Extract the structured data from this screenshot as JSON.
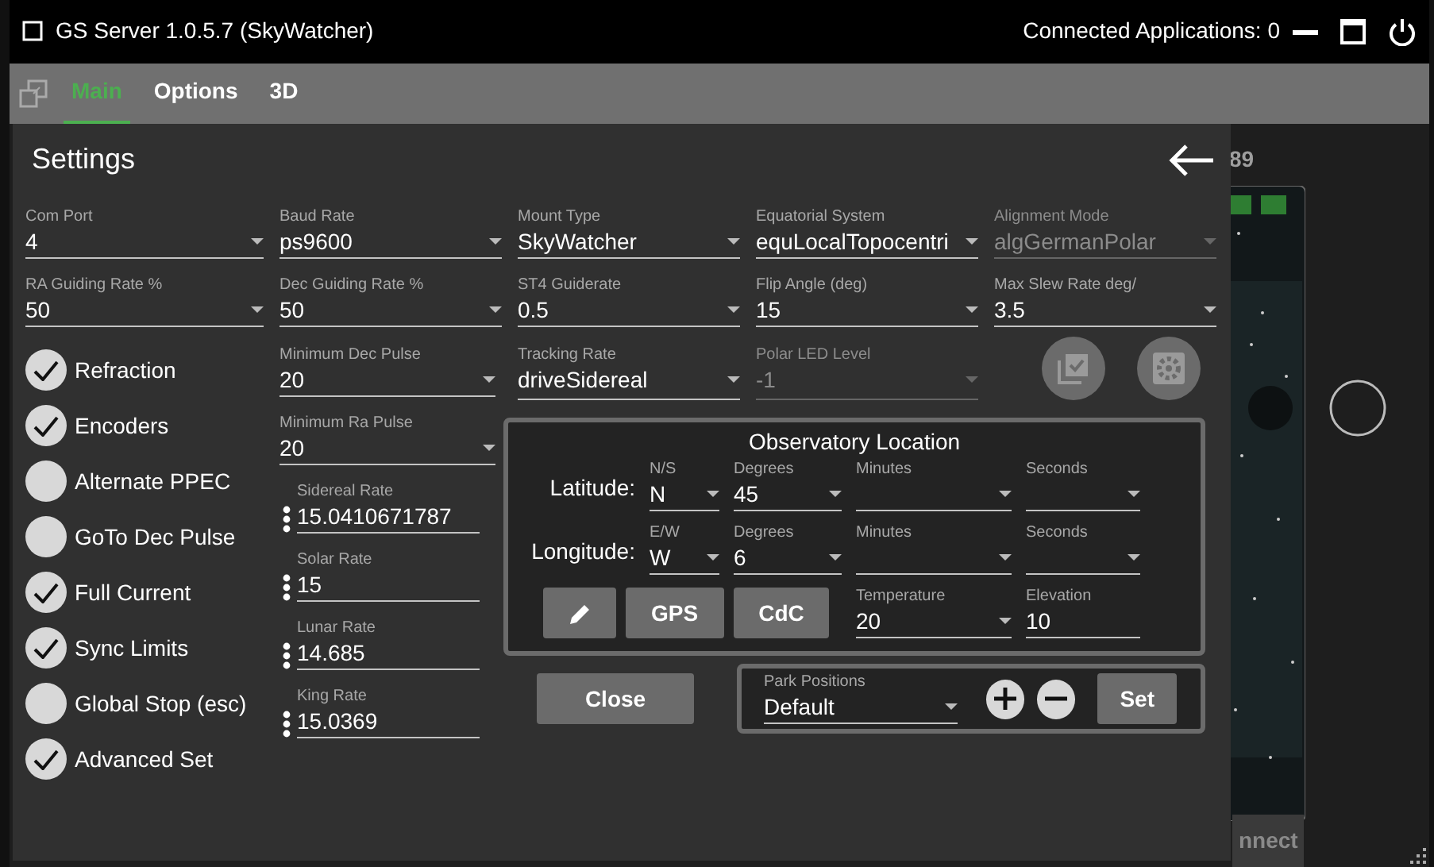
{
  "title_bar": {
    "title": "GS Server 1.0.5.7 (SkyWatcher)",
    "connected": "Connected Applications: 0"
  },
  "tabs": [
    {
      "label": "Main",
      "selected": true
    },
    {
      "label": "Options",
      "selected": false
    },
    {
      "label": "3D",
      "selected": false
    }
  ],
  "background": {
    "number": "89",
    "connect_button": "nnect"
  },
  "settings": {
    "title": "Settings",
    "selects": [
      {
        "label": "Com Port",
        "value": "4",
        "disabled": false
      },
      {
        "label": "Baud Rate",
        "value": "ps9600",
        "disabled": false
      },
      {
        "label": "Mount Type",
        "value": "SkyWatcher",
        "disabled": false
      },
      {
        "label": "Equatorial System",
        "value": "equLocalTopocentri",
        "disabled": false
      },
      {
        "label": "Alignment Mode",
        "value": "algGermanPolar",
        "disabled": true
      },
      {
        "label": "RA Guiding Rate %",
        "value": "50",
        "disabled": false
      },
      {
        "label": "Dec Guiding Rate %",
        "value": "50",
        "disabled": false
      },
      {
        "label": "ST4 Guiderate",
        "value": "0.5",
        "disabled": false
      },
      {
        "label": "Flip Angle (deg)",
        "value": "15",
        "disabled": false
      },
      {
        "label": "Max Slew Rate deg/",
        "value": "3.5",
        "disabled": false
      }
    ],
    "checks": [
      {
        "label": "Refraction",
        "checked": true
      },
      {
        "label": "Encoders",
        "checked": true
      },
      {
        "label": "Alternate PPEC",
        "checked": false
      },
      {
        "label": "GoTo Dec Pulse",
        "checked": false
      },
      {
        "label": "Full Current",
        "checked": true
      },
      {
        "label": "Sync Limits",
        "checked": true
      },
      {
        "label": "Global Stop (esc)",
        "checked": false
      },
      {
        "label": "Advanced Set",
        "checked": true
      }
    ],
    "pulses": [
      {
        "label": "Minimum Dec Pulse",
        "value": "20"
      },
      {
        "label": "Minimum Ra Pulse",
        "value": "20"
      }
    ],
    "rates": [
      {
        "label": "Sidereal Rate",
        "value": "15.0410671787"
      },
      {
        "label": "Solar Rate",
        "value": "15"
      },
      {
        "label": "Lunar Rate",
        "value": "14.685"
      },
      {
        "label": "King Rate",
        "value": "15.0369"
      }
    ],
    "tracking_rate": {
      "label": "Tracking Rate",
      "value": "driveSidereal",
      "disabled": false
    },
    "polar_led": {
      "label": "Polar LED Level",
      "value": "-1",
      "disabled": true
    },
    "observatory": {
      "title": "Observatory Location",
      "rows": [
        {
          "label": "Latitude:",
          "hemisphere_label": "N/S",
          "hemisphere": "N",
          "degrees_label": "Degrees",
          "degrees": "45",
          "minutes_label": "Minutes",
          "seconds_label": "Seconds"
        },
        {
          "label": "Longitude:",
          "hemisphere_label": "E/W",
          "hemisphere": "W",
          "degrees_label": "Degrees",
          "degrees": "6",
          "minutes_label": "Minutes",
          "seconds_label": "Seconds"
        }
      ],
      "buttons": [
        "GPS",
        "CdC"
      ],
      "temperature": {
        "label": "Temperature",
        "value": "20"
      },
      "elevation": {
        "label": "Elevation",
        "value": "10"
      }
    },
    "close": "Close",
    "park": {
      "label": "Park Positions",
      "value": "Default",
      "set": "Set"
    }
  }
}
